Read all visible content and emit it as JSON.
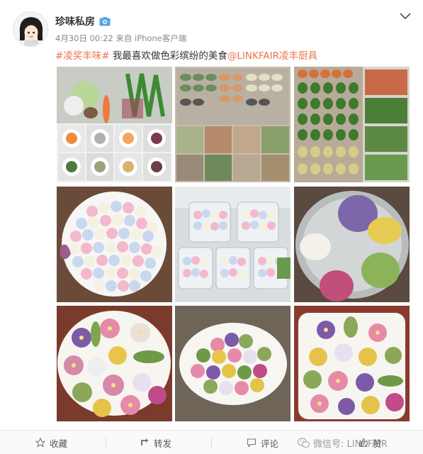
{
  "user": {
    "name": "珍味私房",
    "timestamp": "4月30日 00:22",
    "source": "来自 iPhone客户端"
  },
  "post": {
    "hashtag": "#凌奖丰味#",
    "text": " 我最喜欢做色彩缤纷的美食",
    "mention": "@LINKFAIR凌丰厨具"
  },
  "images": [
    {
      "label": "vegetables-and-bowls-collage"
    },
    {
      "label": "dumpling-trays-collage"
    },
    {
      "label": "green-and-orange-dumplings-collage"
    },
    {
      "label": "pastel-dough-balls-plate"
    },
    {
      "label": "dough-balls-in-jars"
    },
    {
      "label": "colored-dough-in-bowl"
    },
    {
      "label": "flower-pastries-plate"
    },
    {
      "label": "flower-pastries-round-plate"
    },
    {
      "label": "flower-pastries-tray"
    }
  ],
  "actions": {
    "favorite": "收藏",
    "repost": "转发",
    "comment": "评论",
    "like": "赞"
  },
  "watermark": {
    "text": "微信号: LINKFAIR"
  },
  "colors": {
    "link": "#eb7350",
    "meta": "#8a8a8a",
    "badge": "#52a6e8"
  }
}
